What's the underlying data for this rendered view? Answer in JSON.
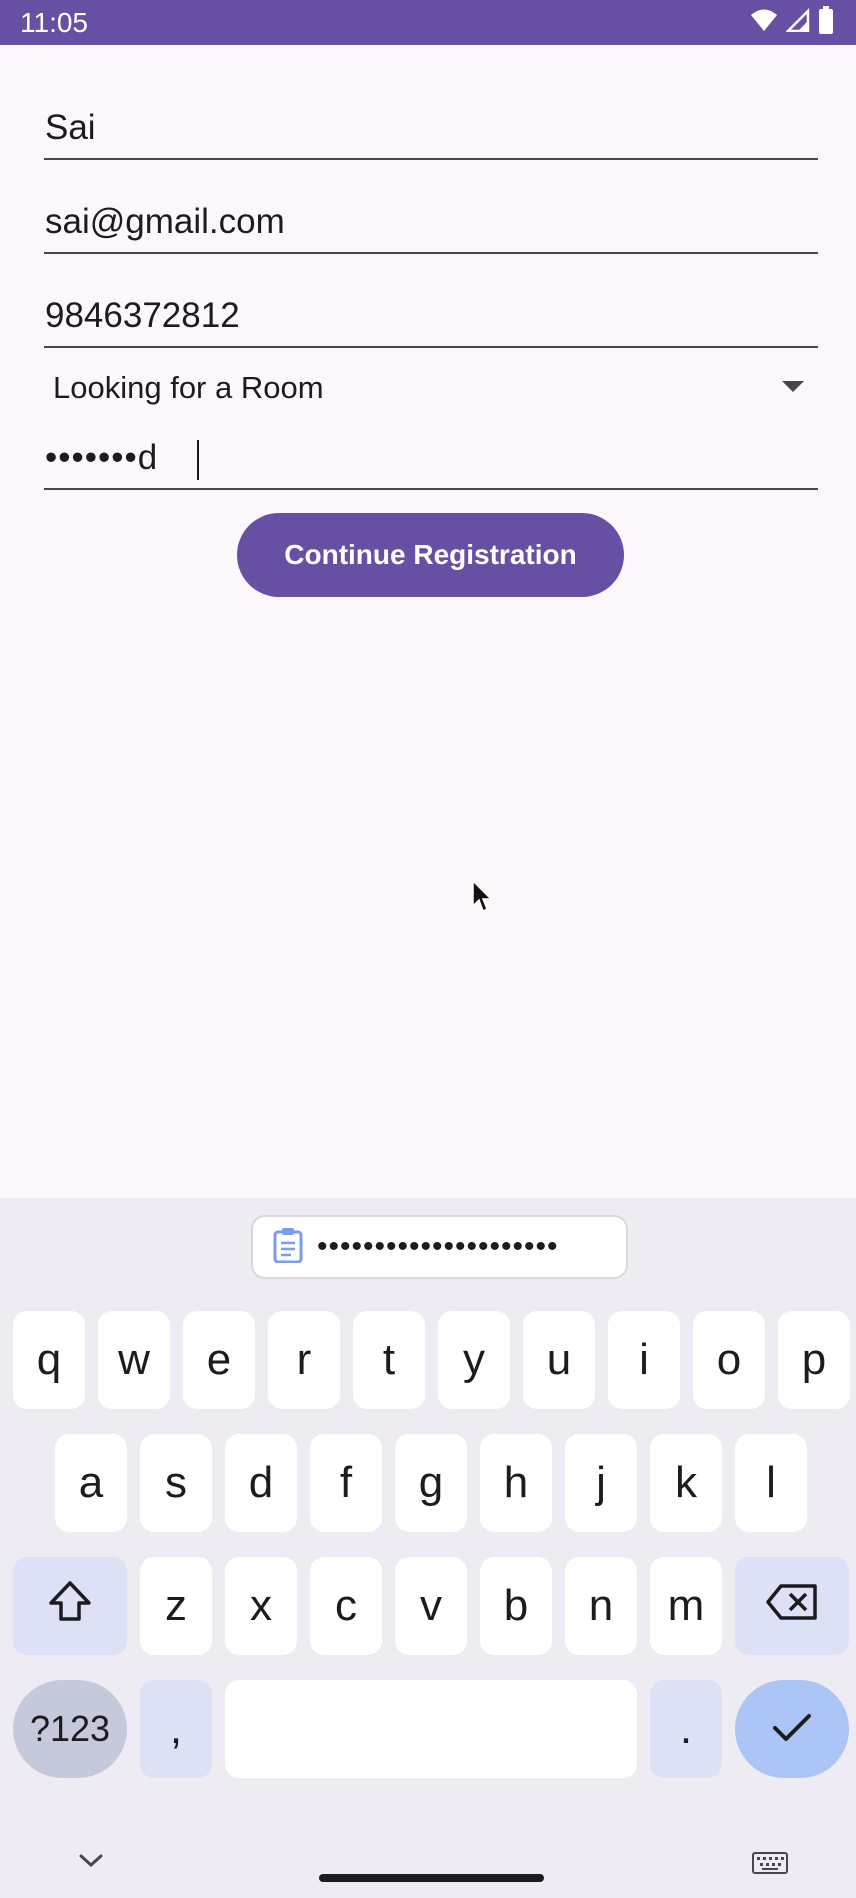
{
  "status_bar": {
    "time": "11:05",
    "icons": [
      "wifi-icon",
      "cell-signal-icon",
      "battery-icon"
    ]
  },
  "form": {
    "name_value": "Sai",
    "email_value": "sai@gmail.com",
    "phone_value": "9846372812",
    "role_selected": "Looking for a Room",
    "password_value": "•••••••d",
    "continue_label": "Continue Registration"
  },
  "keyboard": {
    "clipboard_suggestion": "•••••••••••••••••••••",
    "row1": [
      "q",
      "w",
      "e",
      "r",
      "t",
      "y",
      "u",
      "i",
      "o",
      "p"
    ],
    "row2": [
      "a",
      "s",
      "d",
      "f",
      "g",
      "h",
      "j",
      "k",
      "l"
    ],
    "row3": [
      "z",
      "x",
      "c",
      "v",
      "b",
      "n",
      "m"
    ],
    "symbols_label": "?123",
    "comma_label": ",",
    "period_label": "."
  },
  "colors": {
    "accent": "#6750A4",
    "background": "#FDF8FC",
    "keyboard_bg": "#EEEBF2"
  }
}
